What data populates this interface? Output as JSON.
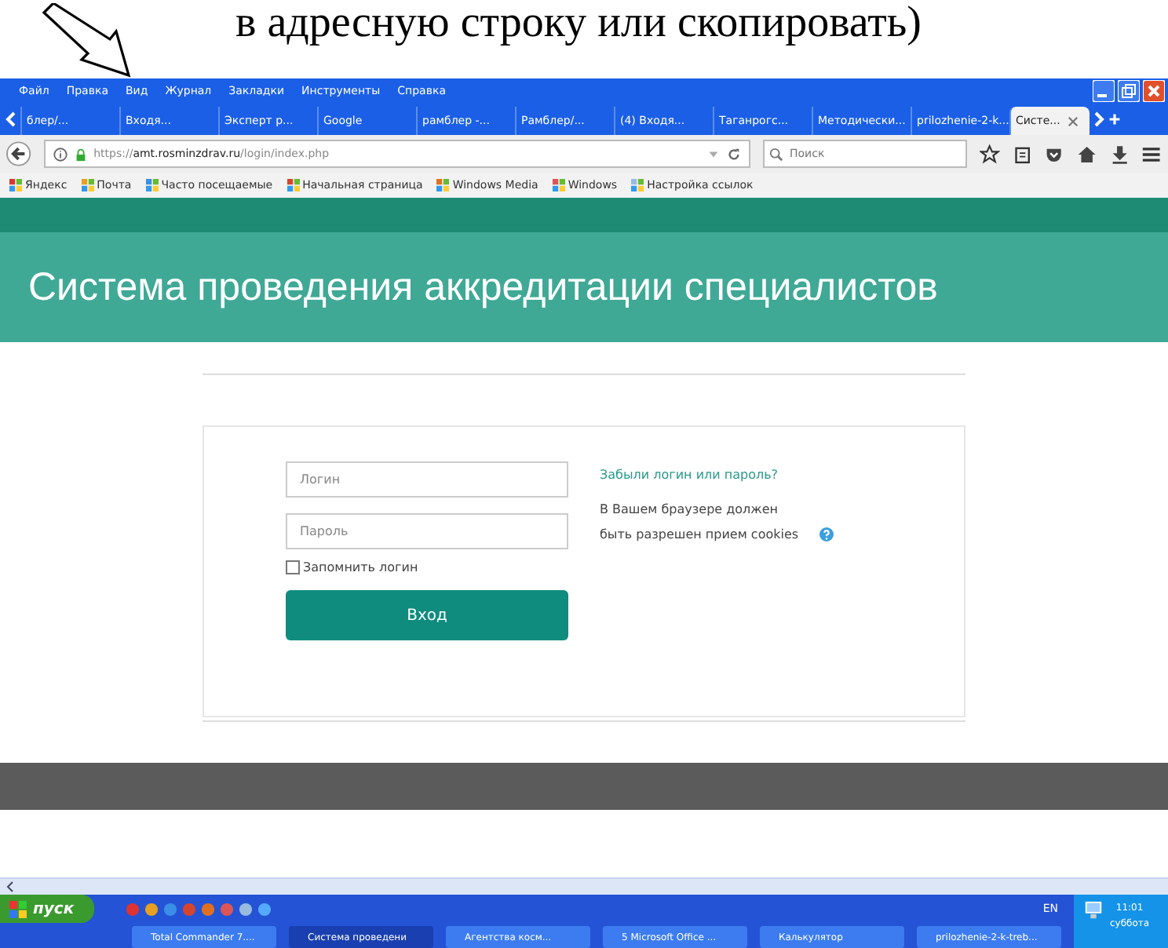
{
  "document_text": "в адресную строку или скопировать)",
  "menu": [
    "Файл",
    "Правка",
    "Вид",
    "Журнал",
    "Закладки",
    "Инструменты",
    "Справка"
  ],
  "tabs": [
    {
      "label": "блер/...",
      "selected": false
    },
    {
      "label": "Входя...",
      "selected": false
    },
    {
      "label": "Эксперт р...",
      "selected": false
    },
    {
      "label": "Google",
      "selected": false
    },
    {
      "label": "рамблер -...",
      "selected": false
    },
    {
      "label": "Рамблер/...",
      "selected": false
    },
    {
      "label": "(4) Входя...",
      "selected": false
    },
    {
      "label": "Таганрогс...",
      "selected": false
    },
    {
      "label": "Методически...",
      "selected": false
    },
    {
      "label": "prilozhenie-2-k...",
      "selected": false
    },
    {
      "label": "Систе...",
      "selected": true
    }
  ],
  "address": "https://**amt.rosminzdrav.ru**/login/index.php",
  "search": {
    "placeholder": "Поиск"
  },
  "bookmarks": [
    "Яндекс",
    "Почта",
    "Часто посещаемые",
    "Начальная страница",
    "Windows Media",
    "Windows",
    "Настройка ссылок"
  ],
  "page": {
    "title": "Система проведения аккредитации специалистов",
    "login": {
      "placeholder": "Логин"
    },
    "password": {
      "placeholder": "Пароль"
    },
    "remember": {
      "label": "Запомнить логин",
      "checked": false
    },
    "submit": "Вход",
    "forgot": "Забыли логин или пароль?",
    "cookies": "В Вашем браузере должен быть разрешен прием cookies"
  },
  "taskbar": {
    "start": "пуск",
    "tasks": [
      {
        "label": "Total Commander 7....",
        "selected": false
      },
      {
        "label": "Система проведени",
        "selected": true
      },
      {
        "label": "Агентства косм...",
        "selected": false
      },
      {
        "label": "5 Microsoft Office ...",
        "selected": false
      },
      {
        "label": "Калькулятор",
        "selected": false
      },
      {
        "label": "prilozhenie-2-k-treb...",
        "selected": false
      }
    ],
    "language": "EN",
    "time": "11:01",
    "day": "суббота"
  }
}
